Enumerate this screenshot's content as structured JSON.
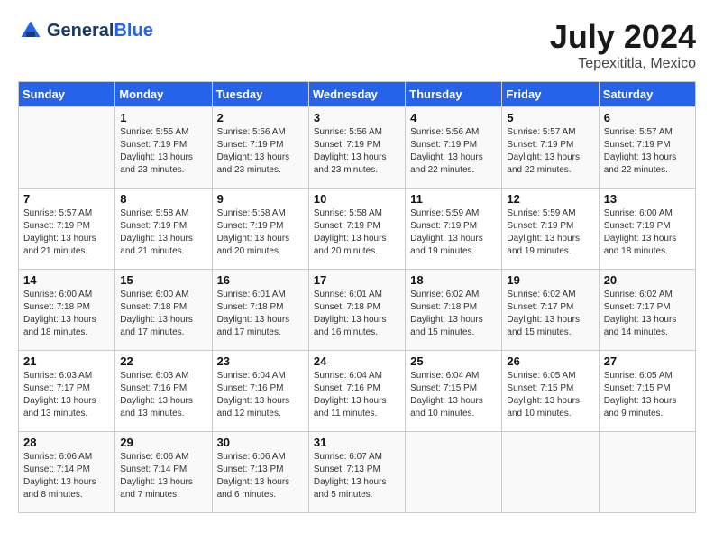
{
  "header": {
    "logo_general": "General",
    "logo_blue": "Blue",
    "month_year": "July 2024",
    "location": "Tepexititla, Mexico"
  },
  "days_of_week": [
    "Sunday",
    "Monday",
    "Tuesday",
    "Wednesday",
    "Thursday",
    "Friday",
    "Saturday"
  ],
  "weeks": [
    [
      {
        "day": "",
        "sunrise": "",
        "sunset": "",
        "daylight": ""
      },
      {
        "day": "1",
        "sunrise": "Sunrise: 5:55 AM",
        "sunset": "Sunset: 7:19 PM",
        "daylight": "Daylight: 13 hours and 23 minutes."
      },
      {
        "day": "2",
        "sunrise": "Sunrise: 5:56 AM",
        "sunset": "Sunset: 7:19 PM",
        "daylight": "Daylight: 13 hours and 23 minutes."
      },
      {
        "day": "3",
        "sunrise": "Sunrise: 5:56 AM",
        "sunset": "Sunset: 7:19 PM",
        "daylight": "Daylight: 13 hours and 23 minutes."
      },
      {
        "day": "4",
        "sunrise": "Sunrise: 5:56 AM",
        "sunset": "Sunset: 7:19 PM",
        "daylight": "Daylight: 13 hours and 22 minutes."
      },
      {
        "day": "5",
        "sunrise": "Sunrise: 5:57 AM",
        "sunset": "Sunset: 7:19 PM",
        "daylight": "Daylight: 13 hours and 22 minutes."
      },
      {
        "day": "6",
        "sunrise": "Sunrise: 5:57 AM",
        "sunset": "Sunset: 7:19 PM",
        "daylight": "Daylight: 13 hours and 22 minutes."
      }
    ],
    [
      {
        "day": "7",
        "sunrise": "Sunrise: 5:57 AM",
        "sunset": "Sunset: 7:19 PM",
        "daylight": "Daylight: 13 hours and 21 minutes."
      },
      {
        "day": "8",
        "sunrise": "Sunrise: 5:58 AM",
        "sunset": "Sunset: 7:19 PM",
        "daylight": "Daylight: 13 hours and 21 minutes."
      },
      {
        "day": "9",
        "sunrise": "Sunrise: 5:58 AM",
        "sunset": "Sunset: 7:19 PM",
        "daylight": "Daylight: 13 hours and 20 minutes."
      },
      {
        "day": "10",
        "sunrise": "Sunrise: 5:58 AM",
        "sunset": "Sunset: 7:19 PM",
        "daylight": "Daylight: 13 hours and 20 minutes."
      },
      {
        "day": "11",
        "sunrise": "Sunrise: 5:59 AM",
        "sunset": "Sunset: 7:19 PM",
        "daylight": "Daylight: 13 hours and 19 minutes."
      },
      {
        "day": "12",
        "sunrise": "Sunrise: 5:59 AM",
        "sunset": "Sunset: 7:19 PM",
        "daylight": "Daylight: 13 hours and 19 minutes."
      },
      {
        "day": "13",
        "sunrise": "Sunrise: 6:00 AM",
        "sunset": "Sunset: 7:19 PM",
        "daylight": "Daylight: 13 hours and 18 minutes."
      }
    ],
    [
      {
        "day": "14",
        "sunrise": "Sunrise: 6:00 AM",
        "sunset": "Sunset: 7:18 PM",
        "daylight": "Daylight: 13 hours and 18 minutes."
      },
      {
        "day": "15",
        "sunrise": "Sunrise: 6:00 AM",
        "sunset": "Sunset: 7:18 PM",
        "daylight": "Daylight: 13 hours and 17 minutes."
      },
      {
        "day": "16",
        "sunrise": "Sunrise: 6:01 AM",
        "sunset": "Sunset: 7:18 PM",
        "daylight": "Daylight: 13 hours and 17 minutes."
      },
      {
        "day": "17",
        "sunrise": "Sunrise: 6:01 AM",
        "sunset": "Sunset: 7:18 PM",
        "daylight": "Daylight: 13 hours and 16 minutes."
      },
      {
        "day": "18",
        "sunrise": "Sunrise: 6:02 AM",
        "sunset": "Sunset: 7:18 PM",
        "daylight": "Daylight: 13 hours and 15 minutes."
      },
      {
        "day": "19",
        "sunrise": "Sunrise: 6:02 AM",
        "sunset": "Sunset: 7:17 PM",
        "daylight": "Daylight: 13 hours and 15 minutes."
      },
      {
        "day": "20",
        "sunrise": "Sunrise: 6:02 AM",
        "sunset": "Sunset: 7:17 PM",
        "daylight": "Daylight: 13 hours and 14 minutes."
      }
    ],
    [
      {
        "day": "21",
        "sunrise": "Sunrise: 6:03 AM",
        "sunset": "Sunset: 7:17 PM",
        "daylight": "Daylight: 13 hours and 13 minutes."
      },
      {
        "day": "22",
        "sunrise": "Sunrise: 6:03 AM",
        "sunset": "Sunset: 7:16 PM",
        "daylight": "Daylight: 13 hours and 13 minutes."
      },
      {
        "day": "23",
        "sunrise": "Sunrise: 6:04 AM",
        "sunset": "Sunset: 7:16 PM",
        "daylight": "Daylight: 13 hours and 12 minutes."
      },
      {
        "day": "24",
        "sunrise": "Sunrise: 6:04 AM",
        "sunset": "Sunset: 7:16 PM",
        "daylight": "Daylight: 13 hours and 11 minutes."
      },
      {
        "day": "25",
        "sunrise": "Sunrise: 6:04 AM",
        "sunset": "Sunset: 7:15 PM",
        "daylight": "Daylight: 13 hours and 10 minutes."
      },
      {
        "day": "26",
        "sunrise": "Sunrise: 6:05 AM",
        "sunset": "Sunset: 7:15 PM",
        "daylight": "Daylight: 13 hours and 10 minutes."
      },
      {
        "day": "27",
        "sunrise": "Sunrise: 6:05 AM",
        "sunset": "Sunset: 7:15 PM",
        "daylight": "Daylight: 13 hours and 9 minutes."
      }
    ],
    [
      {
        "day": "28",
        "sunrise": "Sunrise: 6:06 AM",
        "sunset": "Sunset: 7:14 PM",
        "daylight": "Daylight: 13 hours and 8 minutes."
      },
      {
        "day": "29",
        "sunrise": "Sunrise: 6:06 AM",
        "sunset": "Sunset: 7:14 PM",
        "daylight": "Daylight: 13 hours and 7 minutes."
      },
      {
        "day": "30",
        "sunrise": "Sunrise: 6:06 AM",
        "sunset": "Sunset: 7:13 PM",
        "daylight": "Daylight: 13 hours and 6 minutes."
      },
      {
        "day": "31",
        "sunrise": "Sunrise: 6:07 AM",
        "sunset": "Sunset: 7:13 PM",
        "daylight": "Daylight: 13 hours and 5 minutes."
      },
      {
        "day": "",
        "sunrise": "",
        "sunset": "",
        "daylight": ""
      },
      {
        "day": "",
        "sunrise": "",
        "sunset": "",
        "daylight": ""
      },
      {
        "day": "",
        "sunrise": "",
        "sunset": "",
        "daylight": ""
      }
    ]
  ]
}
